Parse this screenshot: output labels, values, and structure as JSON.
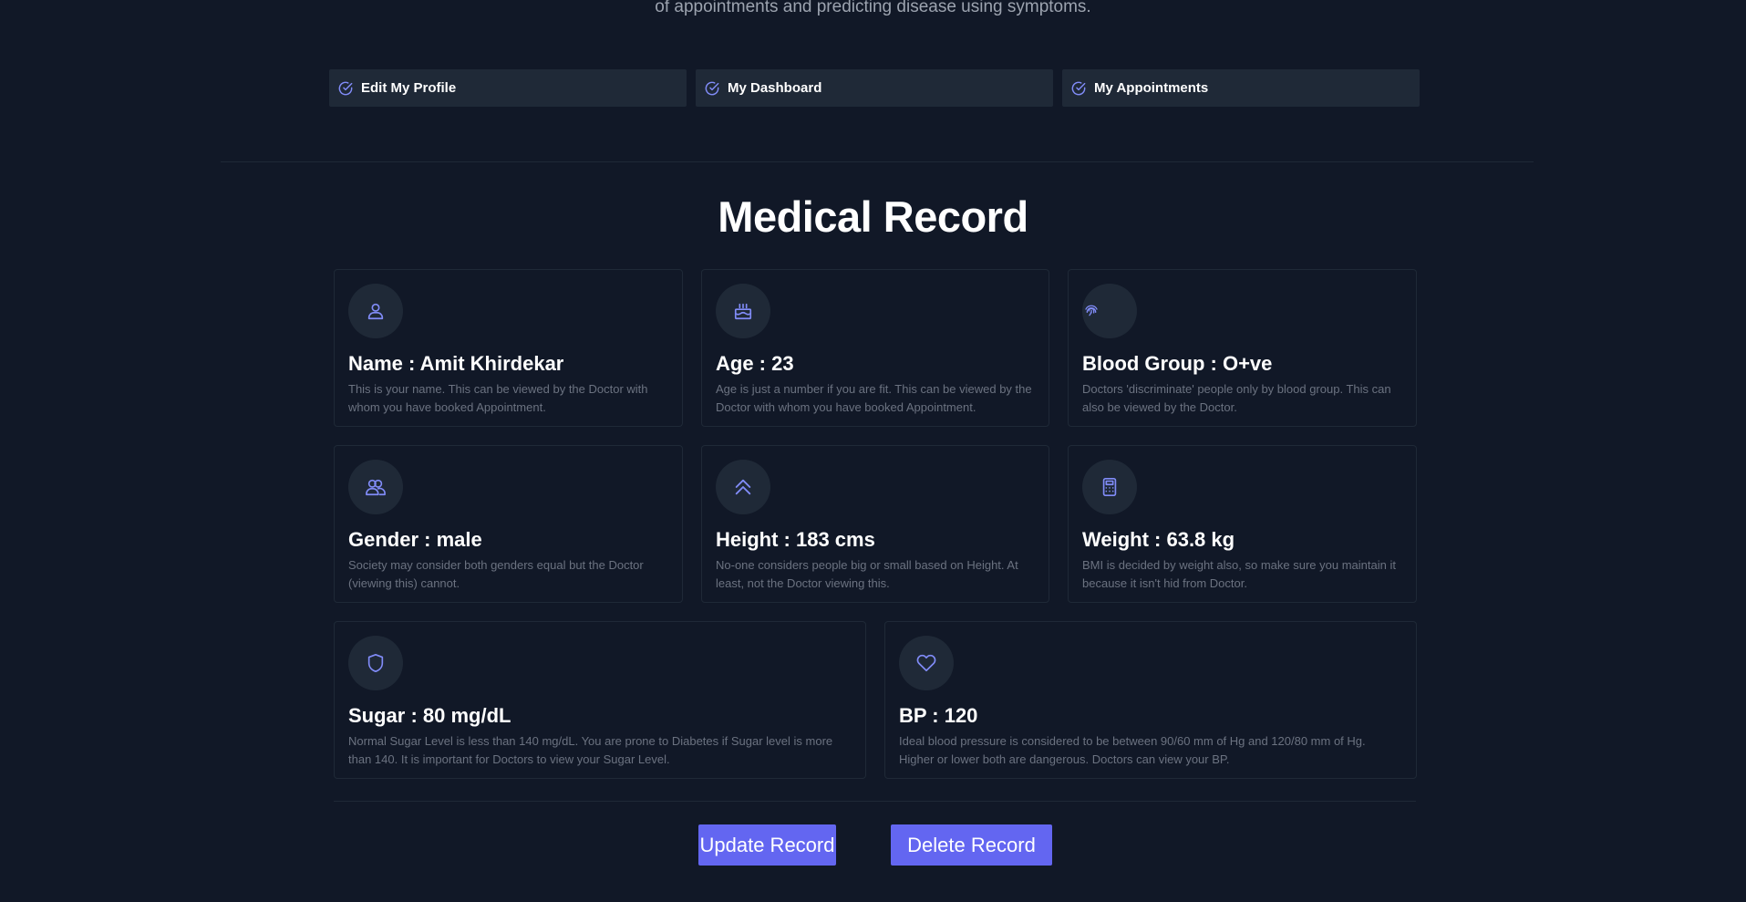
{
  "intro": {
    "text": "of appointments and predicting disease using symptoms."
  },
  "quick_links": [
    {
      "label": "Edit My Profile",
      "icon": "check-circle-icon"
    },
    {
      "label": "My Dashboard",
      "icon": "check-circle-icon"
    },
    {
      "label": "My Appointments",
      "icon": "check-circle-icon"
    }
  ],
  "page_title": "Medical Record",
  "cards": {
    "name": {
      "title": "Name : Amit Khirdekar",
      "desc": "This is your name. This can be viewed by the Doctor with whom you have booked Appointment.",
      "icon": "user-icon"
    },
    "age": {
      "title": "Age : 23",
      "desc": "Age is just a number if you are fit. This can be viewed by the Doctor with whom you have booked Appointment.",
      "icon": "cake-icon"
    },
    "blood_group": {
      "title": "Blood Group : O+ve",
      "desc": "Doctors 'discriminate' people only by blood group. This can also be viewed by the Doctor.",
      "icon": "fingerprint-icon"
    },
    "gender": {
      "title": "Gender : male",
      "desc": "Society may consider both genders equal but the Doctor (viewing this) cannot.",
      "icon": "users-icon"
    },
    "height": {
      "title": "Height : 183 cms",
      "desc": "No-one considers people big or small based on Height. At least, not the Doctor viewing this.",
      "icon": "chevron-double-up-icon"
    },
    "weight": {
      "title": "Weight : 63.8 kg",
      "desc": "BMI is decided by weight also, so make sure you maintain it because it isn't hid from Doctor.",
      "icon": "calculator-icon"
    },
    "sugar": {
      "title": "Sugar : 80 mg/dL",
      "desc": "Normal Sugar Level is less than 140 mg/dL. You are prone to Diabetes if Sugar level is more than 140. It is important for Doctors to view your Sugar Level.",
      "icon": "shield-icon"
    },
    "bp": {
      "title": "BP : 120",
      "desc": "Ideal blood pressure is considered to be between 90/60 mm of Hg and 120/80 mm of Hg. Higher or lower both are dangerous. Doctors can view your BP.",
      "icon": "heart-icon"
    }
  },
  "buttons": {
    "update": "Update Record",
    "delete": "Delete Record"
  },
  "colors": {
    "accent": "#6366f1",
    "background": "#111827",
    "surface": "#1f2937",
    "muted_text": "#6b7280"
  }
}
